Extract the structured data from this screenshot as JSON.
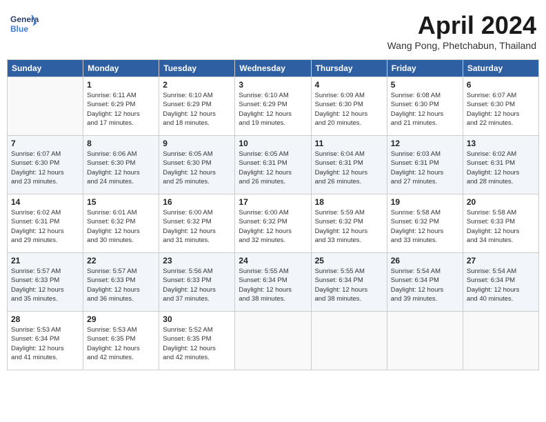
{
  "header": {
    "logo_line1": "General",
    "logo_line2": "Blue",
    "month": "April 2024",
    "location": "Wang Pong, Phetchabun, Thailand"
  },
  "weekdays": [
    "Sunday",
    "Monday",
    "Tuesday",
    "Wednesday",
    "Thursday",
    "Friday",
    "Saturday"
  ],
  "weeks": [
    [
      {
        "day": "",
        "info": ""
      },
      {
        "day": "1",
        "info": "Sunrise: 6:11 AM\nSunset: 6:29 PM\nDaylight: 12 hours\nand 17 minutes."
      },
      {
        "day": "2",
        "info": "Sunrise: 6:10 AM\nSunset: 6:29 PM\nDaylight: 12 hours\nand 18 minutes."
      },
      {
        "day": "3",
        "info": "Sunrise: 6:10 AM\nSunset: 6:29 PM\nDaylight: 12 hours\nand 19 minutes."
      },
      {
        "day": "4",
        "info": "Sunrise: 6:09 AM\nSunset: 6:30 PM\nDaylight: 12 hours\nand 20 minutes."
      },
      {
        "day": "5",
        "info": "Sunrise: 6:08 AM\nSunset: 6:30 PM\nDaylight: 12 hours\nand 21 minutes."
      },
      {
        "day": "6",
        "info": "Sunrise: 6:07 AM\nSunset: 6:30 PM\nDaylight: 12 hours\nand 22 minutes."
      }
    ],
    [
      {
        "day": "7",
        "info": "Sunrise: 6:07 AM\nSunset: 6:30 PM\nDaylight: 12 hours\nand 23 minutes."
      },
      {
        "day": "8",
        "info": "Sunrise: 6:06 AM\nSunset: 6:30 PM\nDaylight: 12 hours\nand 24 minutes."
      },
      {
        "day": "9",
        "info": "Sunrise: 6:05 AM\nSunset: 6:30 PM\nDaylight: 12 hours\nand 25 minutes."
      },
      {
        "day": "10",
        "info": "Sunrise: 6:05 AM\nSunset: 6:31 PM\nDaylight: 12 hours\nand 26 minutes."
      },
      {
        "day": "11",
        "info": "Sunrise: 6:04 AM\nSunset: 6:31 PM\nDaylight: 12 hours\nand 26 minutes."
      },
      {
        "day": "12",
        "info": "Sunrise: 6:03 AM\nSunset: 6:31 PM\nDaylight: 12 hours\nand 27 minutes."
      },
      {
        "day": "13",
        "info": "Sunrise: 6:02 AM\nSunset: 6:31 PM\nDaylight: 12 hours\nand 28 minutes."
      }
    ],
    [
      {
        "day": "14",
        "info": "Sunrise: 6:02 AM\nSunset: 6:31 PM\nDaylight: 12 hours\nand 29 minutes."
      },
      {
        "day": "15",
        "info": "Sunrise: 6:01 AM\nSunset: 6:32 PM\nDaylight: 12 hours\nand 30 minutes."
      },
      {
        "day": "16",
        "info": "Sunrise: 6:00 AM\nSunset: 6:32 PM\nDaylight: 12 hours\nand 31 minutes."
      },
      {
        "day": "17",
        "info": "Sunrise: 6:00 AM\nSunset: 6:32 PM\nDaylight: 12 hours\nand 32 minutes."
      },
      {
        "day": "18",
        "info": "Sunrise: 5:59 AM\nSunset: 6:32 PM\nDaylight: 12 hours\nand 33 minutes."
      },
      {
        "day": "19",
        "info": "Sunrise: 5:58 AM\nSunset: 6:32 PM\nDaylight: 12 hours\nand 33 minutes."
      },
      {
        "day": "20",
        "info": "Sunrise: 5:58 AM\nSunset: 6:33 PM\nDaylight: 12 hours\nand 34 minutes."
      }
    ],
    [
      {
        "day": "21",
        "info": "Sunrise: 5:57 AM\nSunset: 6:33 PM\nDaylight: 12 hours\nand 35 minutes."
      },
      {
        "day": "22",
        "info": "Sunrise: 5:57 AM\nSunset: 6:33 PM\nDaylight: 12 hours\nand 36 minutes."
      },
      {
        "day": "23",
        "info": "Sunrise: 5:56 AM\nSunset: 6:33 PM\nDaylight: 12 hours\nand 37 minutes."
      },
      {
        "day": "24",
        "info": "Sunrise: 5:55 AM\nSunset: 6:34 PM\nDaylight: 12 hours\nand 38 minutes."
      },
      {
        "day": "25",
        "info": "Sunrise: 5:55 AM\nSunset: 6:34 PM\nDaylight: 12 hours\nand 38 minutes."
      },
      {
        "day": "26",
        "info": "Sunrise: 5:54 AM\nSunset: 6:34 PM\nDaylight: 12 hours\nand 39 minutes."
      },
      {
        "day": "27",
        "info": "Sunrise: 5:54 AM\nSunset: 6:34 PM\nDaylight: 12 hours\nand 40 minutes."
      }
    ],
    [
      {
        "day": "28",
        "info": "Sunrise: 5:53 AM\nSunset: 6:34 PM\nDaylight: 12 hours\nand 41 minutes."
      },
      {
        "day": "29",
        "info": "Sunrise: 5:53 AM\nSunset: 6:35 PM\nDaylight: 12 hours\nand 42 minutes."
      },
      {
        "day": "30",
        "info": "Sunrise: 5:52 AM\nSunset: 6:35 PM\nDaylight: 12 hours\nand 42 minutes."
      },
      {
        "day": "",
        "info": ""
      },
      {
        "day": "",
        "info": ""
      },
      {
        "day": "",
        "info": ""
      },
      {
        "day": "",
        "info": ""
      }
    ]
  ]
}
